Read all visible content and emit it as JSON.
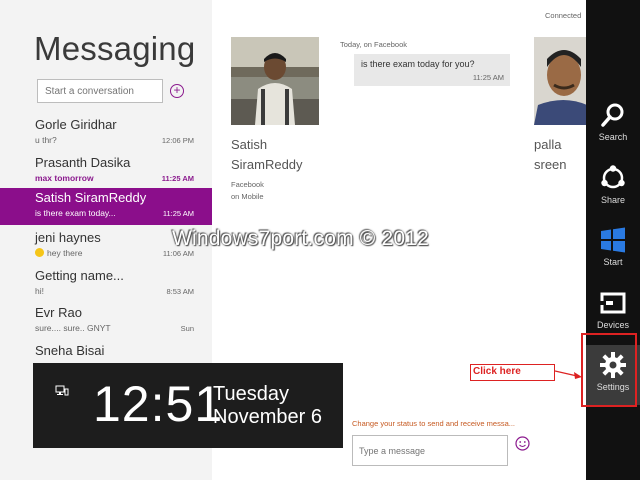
{
  "app": {
    "title": "Messaging"
  },
  "search": {
    "placeholder": "Start a conversation"
  },
  "conversations": [
    {
      "name": "Gorle Giridhar",
      "preview": "u thr?",
      "time": "12:06 PM"
    },
    {
      "name": "Prasanth Dasika",
      "preview": "max tomorrow",
      "time": "11:25 AM"
    },
    {
      "name": "Satish SiramReddy",
      "preview": "is there exam today...",
      "time": "11:25 AM"
    },
    {
      "name": "jeni haynes",
      "preview": "hey there",
      "time": "11:06 AM"
    },
    {
      "name": "Getting name...",
      "preview": "hi!",
      "time": "8:53 AM"
    },
    {
      "name": "Evr Rao",
      "preview": "sure.... sure.. GNYT",
      "time": "Sun"
    },
    {
      "name": "Sneha Bisai",
      "preview": "",
      "time": ""
    }
  ],
  "clock": {
    "time": "12:51",
    "day": "Tuesday",
    "date": "November 6"
  },
  "status": {
    "connected": "Connected"
  },
  "contact": {
    "first": "Satish",
    "last": "SiramReddy",
    "source_line1": "Facebook",
    "source_line2": "on Mobile"
  },
  "thread": {
    "date_label": "Today, on Facebook",
    "message": "is there exam today for you?",
    "time": "11:25 AM"
  },
  "other_contact": {
    "line1": "palla",
    "line2": "sreen"
  },
  "watermark": "Windows7port.com © 2012",
  "compose": {
    "status_prompt": "Change your status to send and receive messa...",
    "placeholder": "Type a message"
  },
  "annotation": {
    "click_here": "Click here"
  },
  "charms": [
    {
      "label": "Search",
      "icon": "search-icon"
    },
    {
      "label": "Share",
      "icon": "share-icon"
    },
    {
      "label": "Start",
      "icon": "windows-logo-icon"
    },
    {
      "label": "Devices",
      "icon": "devices-icon"
    },
    {
      "label": "Settings",
      "icon": "gear-icon"
    }
  ],
  "colors": {
    "accent": "#8b0e8b",
    "charms_bg": "#111111",
    "annotation": "#dd2222"
  }
}
